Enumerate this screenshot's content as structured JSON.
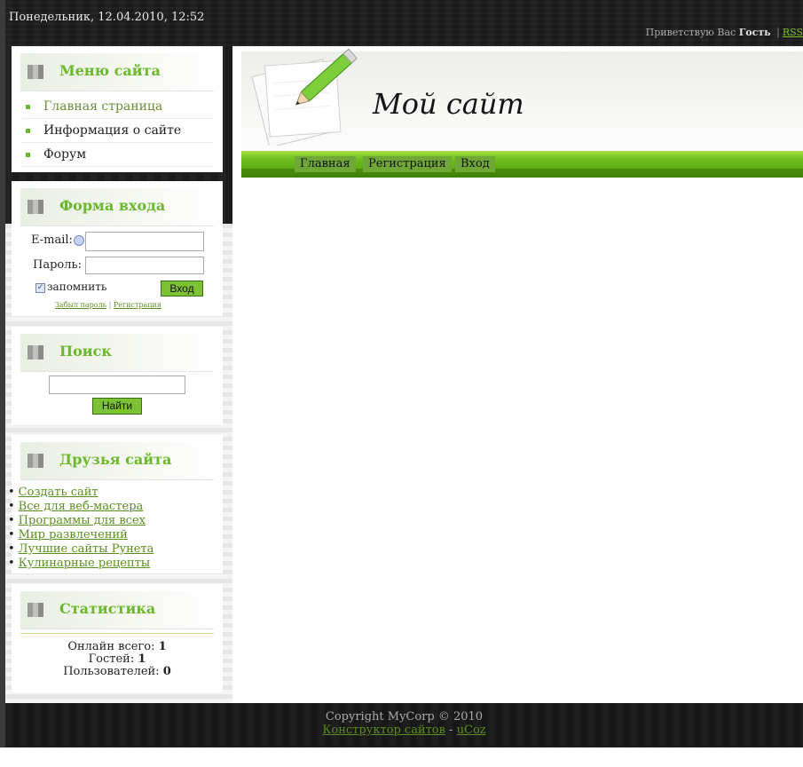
{
  "header": {
    "datetime": "Понедельник, 12.04.2010, 12:52",
    "greeting_prefix": "Приветствую Вас",
    "user": "Гость",
    "separator": "|",
    "rss": "RSS"
  },
  "site": {
    "title": "Мой сайт",
    "nav": [
      "Главная",
      "Регистрация",
      "Вход"
    ]
  },
  "menu": {
    "title": "Меню сайта",
    "items": [
      "Главная страница",
      "Информация о сайте",
      "Форум"
    ]
  },
  "login": {
    "title": "Форма входа",
    "email_label": "E-mail:",
    "password_label": "Пароль:",
    "remember_label": "запомнить",
    "remember_checked": true,
    "submit": "Вход",
    "forgot": "Забыл пароль",
    "links_sep": "|",
    "register": "Регистрация"
  },
  "search": {
    "title": "Поиск",
    "button": "Найти"
  },
  "friends": {
    "title": "Друзья сайта",
    "links": [
      "Создать сайт",
      "Все для веб-мастера",
      "Программы для всех",
      "Мир развлечений",
      "Лучшие сайты Рунета",
      "Кулинарные рецепты"
    ]
  },
  "stats": {
    "title": "Статистика",
    "online_label": "Онлайн всего:",
    "online": "1",
    "guests_label": "Гостей:",
    "guests": "1",
    "users_label": "Пользователей:",
    "users": "0"
  },
  "footer": {
    "copyright": "Copyright MyCorp © 2010",
    "builder": "Конструктор сайтов",
    "dash": "-",
    "ucoz": "uCoz"
  },
  "colors": {
    "accent_green": "#6ab82c",
    "link_green": "#5b8e20",
    "dark_bg": "#1e1e1e"
  }
}
